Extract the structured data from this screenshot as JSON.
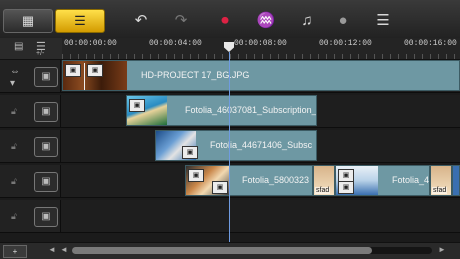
{
  "toolbar": {
    "storyboard_icon": "film-strip-icon",
    "timeline_icon": "timeline-view-icon",
    "tools": [
      {
        "name": "undo-icon",
        "glyph": "↶"
      },
      {
        "name": "redo-icon",
        "glyph": "↷"
      },
      {
        "name": "record-capture-icon",
        "glyph": "⏺"
      },
      {
        "name": "sound-mixer-icon",
        "glyph": "♒"
      },
      {
        "name": "auto-music-icon",
        "glyph": "♫"
      },
      {
        "name": "motion-tracking-icon",
        "glyph": "●"
      },
      {
        "name": "subtitle-editor-icon",
        "glyph": "☰"
      }
    ]
  },
  "ruler": {
    "timecodes": [
      "00:00:00:00",
      "00:00:04:00",
      "00:00:08:00",
      "00:00:12:00",
      "00:00:16:00"
    ],
    "zoom_icon": "fit-project-icon"
  },
  "tracks": [
    {
      "icon": "video-track-icon",
      "clips": [
        {
          "label": "HD-PROJECT 17_BG.JPG",
          "thumb": "wood"
        }
      ]
    },
    {
      "icon": "overlay-track-icon",
      "clips": [
        {
          "label": "Fotolia_46037081_Subscription_",
          "thumb": "beach"
        }
      ]
    },
    {
      "icon": "overlay-track-icon",
      "clips": [
        {
          "label": "Fotolia_44671406_Subsc",
          "thumb": "phone"
        }
      ]
    },
    {
      "icon": "overlay-track-icon",
      "clips": [
        {
          "label": "Fotolia_5800323",
          "thumb": "person"
        },
        {
          "label": "",
          "thumb": "face",
          "sfad": "sfad"
        },
        {
          "label": "Fotolia_4",
          "thumb": "ski"
        },
        {
          "label": "",
          "thumb": "face",
          "sfad": "sfad"
        }
      ]
    },
    {
      "icon": "overlay-track-icon",
      "clips": []
    }
  ],
  "bottom": {
    "add_track_label": "+",
    "scroll_left": "◄",
    "scroll_right": "►"
  }
}
